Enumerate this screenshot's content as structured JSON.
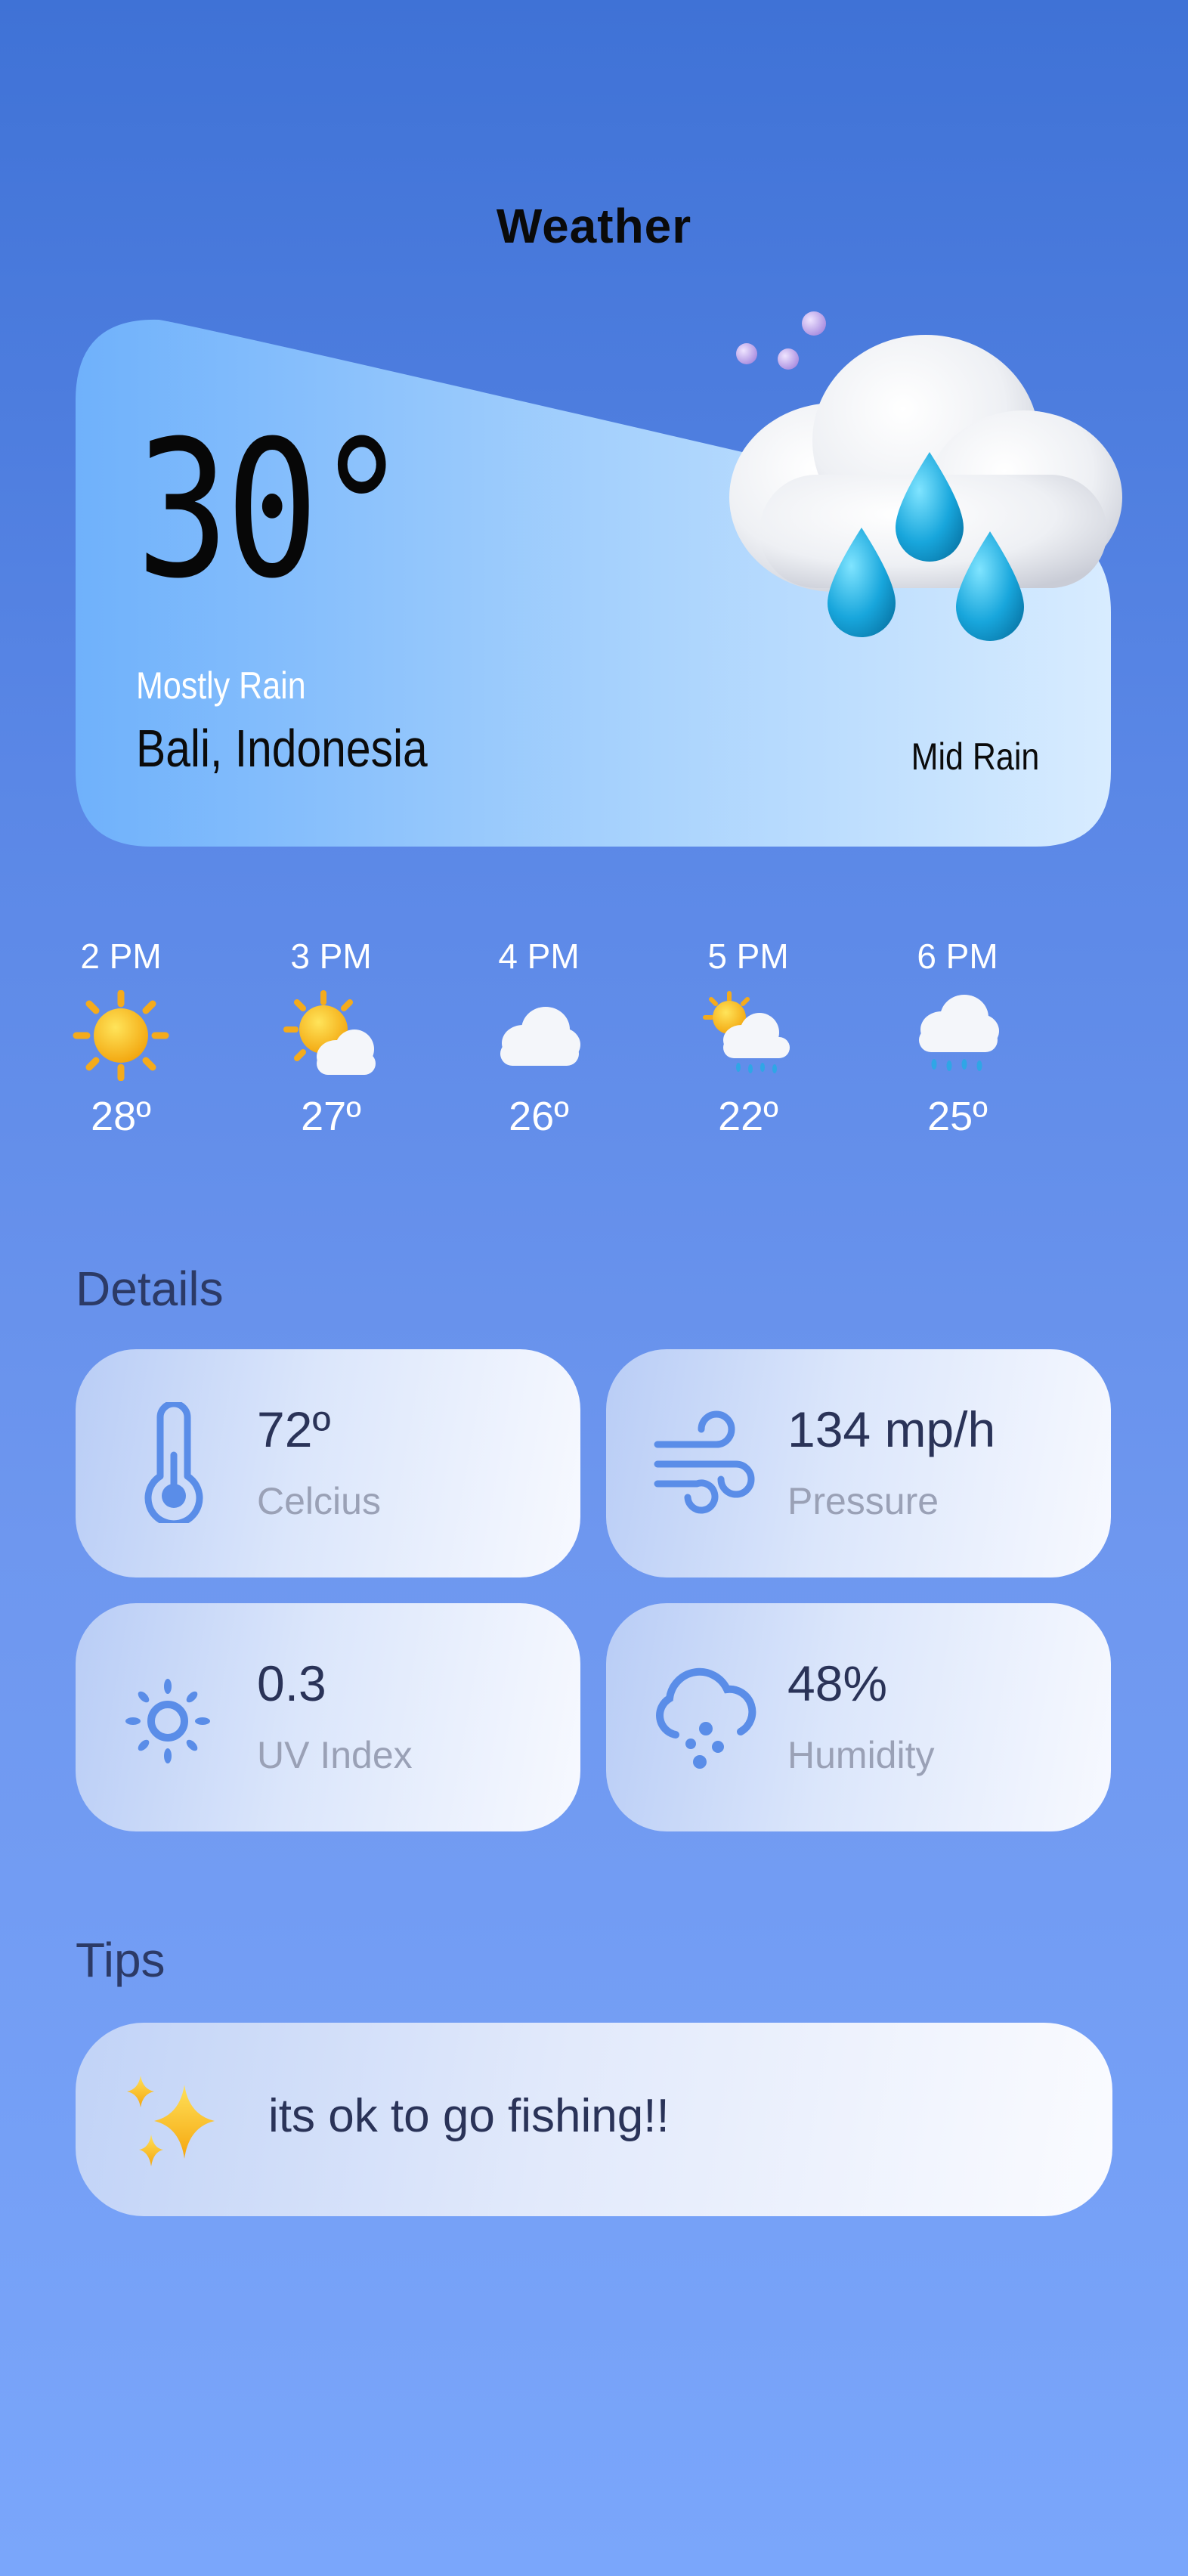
{
  "header": {
    "title": "Weather"
  },
  "current": {
    "temperature": "30°",
    "condition": "Mostly Rain",
    "location": "Bali, Indonesia",
    "intensity": "Mid Rain",
    "icon": "cloud-moon-rain-icon"
  },
  "hourly": [
    {
      "time": "2 PM",
      "temp": "28º",
      "icon": "sun-icon"
    },
    {
      "time": "3 PM",
      "temp": "27º",
      "icon": "sun-cloud-icon"
    },
    {
      "time": "4 PM",
      "temp": "26º",
      "icon": "cloud-icon"
    },
    {
      "time": "5 PM",
      "temp": "22º",
      "icon": "sun-cloud-rain-icon"
    },
    {
      "time": "6 PM",
      "temp": "25º",
      "icon": "cloud-rain-icon"
    }
  ],
  "details": {
    "title": "Details",
    "items": [
      {
        "value": "72º",
        "label": "Celcius",
        "icon": "thermometer-icon"
      },
      {
        "value": "134 mp/h",
        "label": "Pressure",
        "icon": "wind-icon"
      },
      {
        "value": "0.3",
        "label": "UV Index",
        "icon": "sun-uv-icon"
      },
      {
        "value": "48%",
        "label": "Humidity",
        "icon": "cloud-humidity-icon"
      }
    ]
  },
  "tips": {
    "title": "Tips",
    "text": "its ok to go fishing!!",
    "icon": "sparkles-icon"
  },
  "colors": {
    "background_top": "#3f72d6",
    "background_bottom": "#7aa6fb",
    "accent": "#5a8de8",
    "text_dark": "#2a3358",
    "text_muted": "#9aa1b6"
  }
}
